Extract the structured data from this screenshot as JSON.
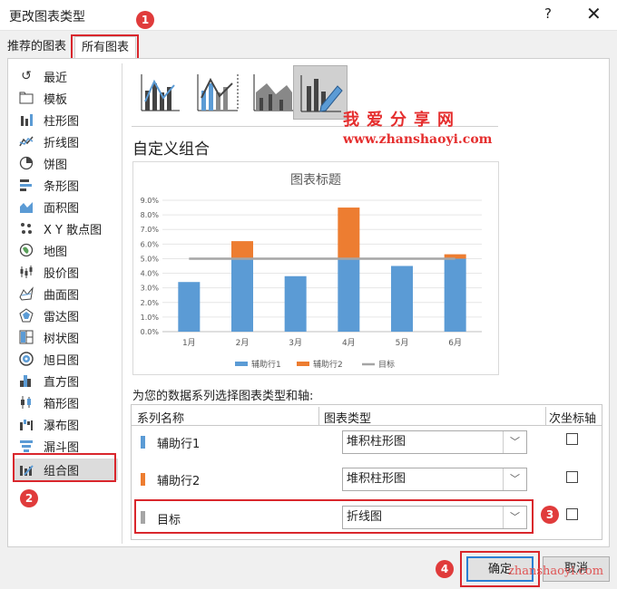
{
  "window": {
    "title": "更改图表类型",
    "help": "?",
    "close": "✕"
  },
  "tabs": [
    {
      "label": "推荐的图表"
    },
    {
      "label": "所有图表"
    }
  ],
  "badges": [
    "1",
    "2",
    "3",
    "4"
  ],
  "sidebar": {
    "items": [
      {
        "label": "最近",
        "icon": "recent-icon"
      },
      {
        "label": "模板",
        "icon": "folder-icon"
      },
      {
        "label": "柱形图",
        "icon": "column-chart-icon"
      },
      {
        "label": "折线图",
        "icon": "line-chart-icon"
      },
      {
        "label": "饼图",
        "icon": "pie-chart-icon"
      },
      {
        "label": "条形图",
        "icon": "bar-chart-icon"
      },
      {
        "label": "面积图",
        "icon": "area-chart-icon"
      },
      {
        "label": "X Y 散点图",
        "icon": "scatter-chart-icon"
      },
      {
        "label": "地图",
        "icon": "map-chart-icon"
      },
      {
        "label": "股价图",
        "icon": "stock-chart-icon"
      },
      {
        "label": "曲面图",
        "icon": "surface-chart-icon"
      },
      {
        "label": "雷达图",
        "icon": "radar-chart-icon"
      },
      {
        "label": "树状图",
        "icon": "treemap-chart-icon"
      },
      {
        "label": "旭日图",
        "icon": "sunburst-chart-icon"
      },
      {
        "label": "直方图",
        "icon": "histogram-chart-icon"
      },
      {
        "label": "箱形图",
        "icon": "boxplot-chart-icon"
      },
      {
        "label": "瀑布图",
        "icon": "waterfall-chart-icon"
      },
      {
        "label": "漏斗图",
        "icon": "funnel-chart-icon"
      },
      {
        "label": "组合图",
        "icon": "combo-chart-icon"
      }
    ],
    "selected_index": 18
  },
  "watermark": {
    "line1": "我爱分享网",
    "line2": "www.zhanshaoyi.com",
    "line3": "zhanshaoyi.com"
  },
  "main": {
    "section_title": "自定义组合",
    "series_hint": "为您的数据系列选择图表类型和轴:",
    "table_headers": {
      "name": "系列名称",
      "type": "图表类型",
      "secondary": "次坐标轴"
    },
    "rows": [
      {
        "name": "辅助行1",
        "type": "堆积柱形图",
        "color": "#5b9bd5",
        "secondary": false
      },
      {
        "name": "辅助行2",
        "type": "堆积柱形图",
        "color": "#ed7d31",
        "secondary": false
      },
      {
        "name": "目标",
        "type": "折线图",
        "color": "#a5a5a5",
        "secondary": false
      }
    ]
  },
  "buttons": {
    "ok": "确定",
    "cancel": "取消"
  },
  "chart_data": {
    "type": "bar",
    "title": "图表标题",
    "categories": [
      "1月",
      "2月",
      "3月",
      "4月",
      "5月",
      "6月"
    ],
    "series": [
      {
        "name": "辅助行1",
        "type": "stacked-bar",
        "color": "#5b9bd5",
        "values": [
          3.4,
          5.0,
          3.8,
          5.0,
          4.5,
          5.0
        ]
      },
      {
        "name": "辅助行2",
        "type": "stacked-bar",
        "color": "#ed7d31",
        "values": [
          0,
          1.2,
          0,
          3.5,
          0,
          0.3
        ]
      },
      {
        "name": "目标",
        "type": "line",
        "color": "#a5a5a5",
        "values": [
          5.0,
          5.0,
          5.0,
          5.0,
          5.0,
          5.0
        ]
      }
    ],
    "yticks": [
      "0.0%",
      "1.0%",
      "2.0%",
      "3.0%",
      "4.0%",
      "5.0%",
      "6.0%",
      "7.0%",
      "8.0%",
      "9.0%"
    ],
    "ylim": [
      0,
      9
    ],
    "grid": true,
    "legend": "bottom"
  }
}
